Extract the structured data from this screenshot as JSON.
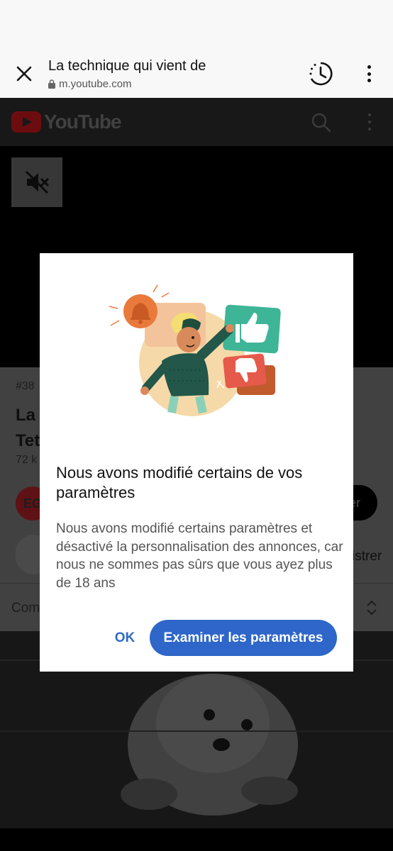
{
  "browser": {
    "title": "La technique qui vient de",
    "url": "m.youtube.com"
  },
  "youtube": {
    "logo_text": "YouTube",
    "video_tag": "#38",
    "video_title_line1": "La",
    "video_title_line2": "Tet",
    "views": "72 k",
    "channel_initials": "EG",
    "subscribe_fragment": "er",
    "save_fragment": "istrer",
    "comments_label": "Com"
  },
  "dialog": {
    "title": "Nous avons modifié certains de vos paramètres",
    "body": "Nous avons modifié certains paramètres et désactivé la personnalisation des annonces, car nous ne sommes pas sûrs que vous ayez plus de 18 ans",
    "ok_label": "OK",
    "review_label": "Examiner les paramètres"
  },
  "colors": {
    "accent": "#2e66c9",
    "dialog_bg": "#ffffff",
    "browser_bg": "#f8f8f8"
  },
  "icons": [
    "close-icon",
    "lock-icon",
    "history-icon",
    "more-vert-icon",
    "search-icon",
    "mute-icon",
    "like-icon",
    "sort-icon"
  ]
}
